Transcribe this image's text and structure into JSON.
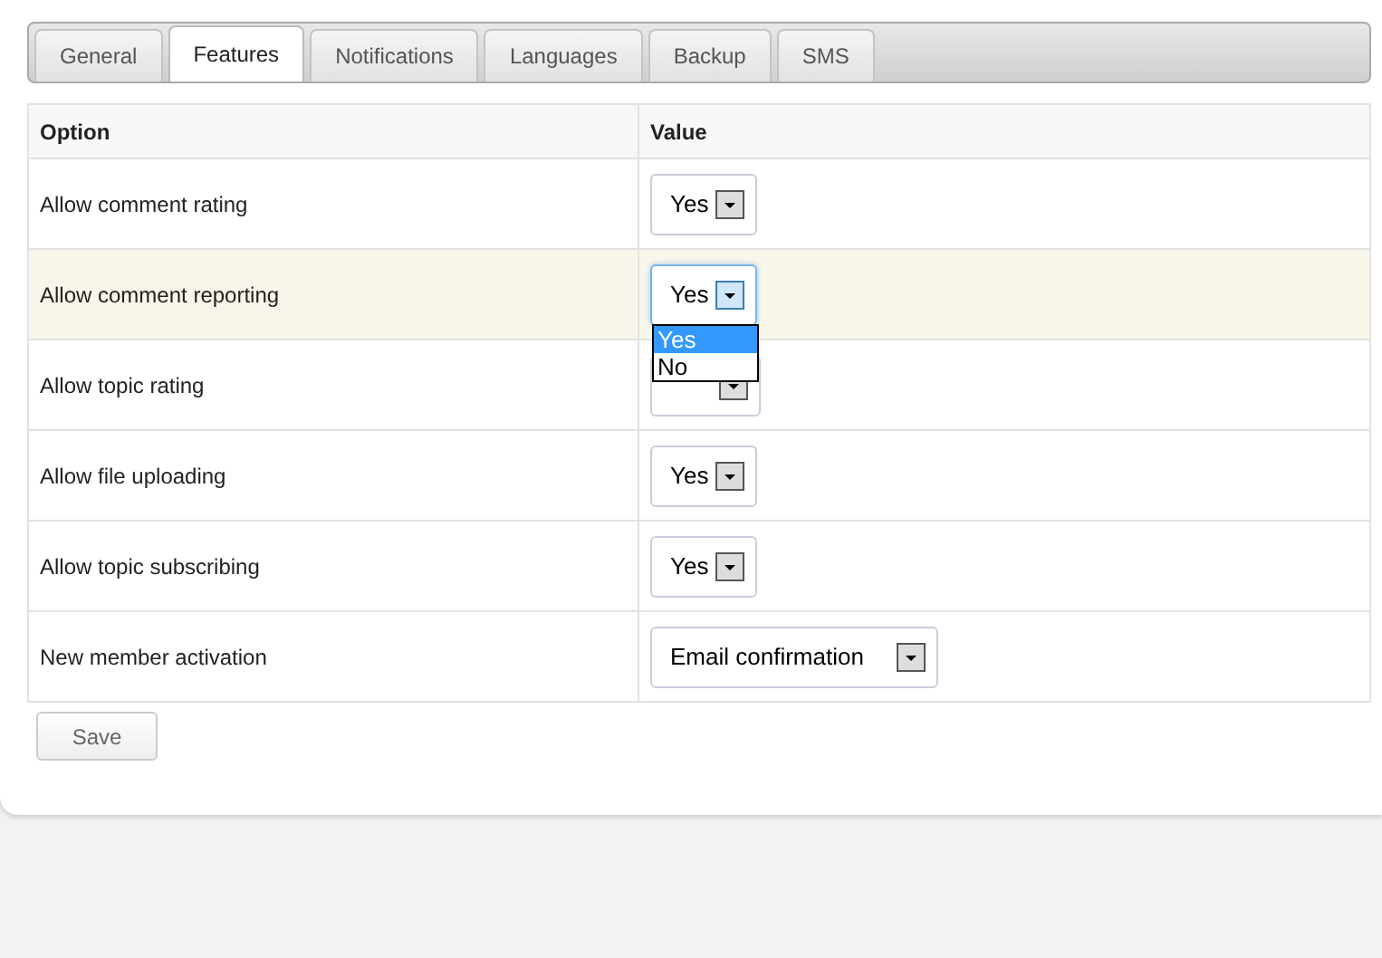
{
  "tabs": [
    {
      "label": "General",
      "selected": false
    },
    {
      "label": "Features",
      "selected": true
    },
    {
      "label": "Notifications",
      "selected": false
    },
    {
      "label": "Languages",
      "selected": false
    },
    {
      "label": "Backup",
      "selected": false
    },
    {
      "label": "SMS",
      "selected": false
    }
  ],
  "table": {
    "columns": [
      "Option",
      "Value"
    ],
    "rows": [
      {
        "option": "Allow comment rating",
        "value": "Yes",
        "highlighted": false,
        "open": false
      },
      {
        "option": "Allow comment reporting",
        "value": "Yes",
        "highlighted": true,
        "open": true,
        "options": [
          {
            "label": "Yes",
            "selected": true
          },
          {
            "label": "No",
            "selected": false
          }
        ]
      },
      {
        "option": "Allow topic rating",
        "highlighted": false,
        "open": false
      },
      {
        "option": "Allow file uploading",
        "value": "Yes",
        "highlighted": false,
        "open": false
      },
      {
        "option": "Allow topic subscribing",
        "value": "Yes",
        "highlighted": false,
        "open": false
      },
      {
        "option": "New member activation",
        "value": "Email confirmation",
        "highlighted": false,
        "open": false
      }
    ]
  },
  "save_button": "Save"
}
